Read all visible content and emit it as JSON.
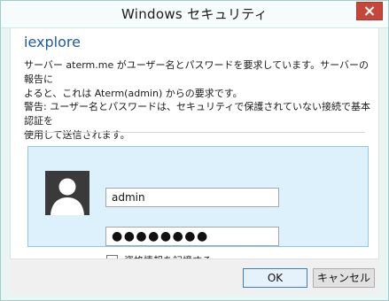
{
  "window": {
    "title": "Windows セキュリティ"
  },
  "dialog": {
    "heading": "iexplore",
    "message": "サーバー aterm.me がユーザー名とパスワードを要求しています。サーバーの報告に\nよると、これは Aterm(admin) からの要求です。",
    "warning": "警告: ユーザー名とパスワードは、セキュリティで保護されていない接続で基本認証を\n使用して送信されます。"
  },
  "credentials": {
    "username": "admin",
    "password_masked": "●●●●●●●●",
    "remember_label": "資格情報を記憶する",
    "remember_checked": false
  },
  "buttons": {
    "ok": "OK",
    "cancel": "キャンセル"
  },
  "icons": {
    "close": "close-icon",
    "user": "user-silhouette-icon"
  }
}
